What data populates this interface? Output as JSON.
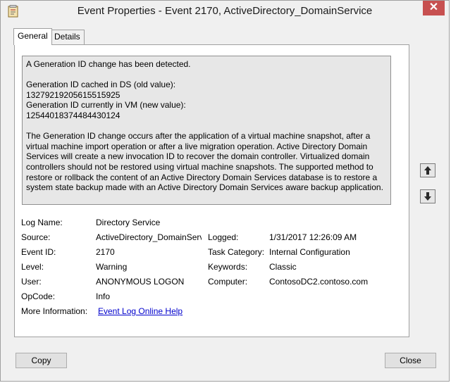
{
  "window": {
    "title": "Event Properties - Event 2170, ActiveDirectory_DomainService",
    "close_glyph": "✕"
  },
  "tabs": [
    {
      "label": "General",
      "active": true
    },
    {
      "label": "Details",
      "active": false
    }
  ],
  "description": {
    "line1": "A Generation ID change has been detected.",
    "cached_label": "Generation ID cached in DS (old value):",
    "cached_value": "13279219205615515925",
    "current_label": "Generation ID currently in VM (new value):",
    "current_value": "12544018374484430124",
    "body": "The Generation ID change occurs after the application of a virtual machine snapshot, after a virtual machine import operation or after a live migration operation. Active Directory Domain Services will create a new invocation ID to recover the domain controller. Virtualized domain controllers should not be restored using virtual machine snapshots. The supported method to restore or rollback the content of an Active Directory Domain Services database is to restore a system state backup made with an Active Directory Domain Services aware backup application."
  },
  "fields": {
    "log_name": {
      "label": "Log Name:",
      "value": "Directory Service"
    },
    "source": {
      "label": "Source:",
      "value": "ActiveDirectory_DomainServ"
    },
    "logged": {
      "label": "Logged:",
      "value": "1/31/2017 12:26:09 AM"
    },
    "event_id": {
      "label": "Event ID:",
      "value": "2170"
    },
    "task_category": {
      "label": "Task Category:",
      "value": "Internal Configuration"
    },
    "level": {
      "label": "Level:",
      "value": "Warning"
    },
    "keywords": {
      "label": "Keywords:",
      "value": "Classic"
    },
    "user": {
      "label": "User:",
      "value": "ANONYMOUS LOGON"
    },
    "computer": {
      "label": "Computer:",
      "value": "ContosoDC2.contoso.com"
    },
    "opcode": {
      "label": "OpCode:",
      "value": "Info"
    },
    "more_info": {
      "label": "More Information:",
      "value": "Event Log Online Help"
    }
  },
  "buttons": {
    "copy": "Copy",
    "close": "Close"
  },
  "icons": {
    "app": "event-viewer-icon",
    "up": "arrow-up-icon",
    "down": "arrow-down-icon"
  },
  "colors": {
    "close_button": "#c75050",
    "link": "#0000cc",
    "description_bg": "#e7e7e7"
  }
}
